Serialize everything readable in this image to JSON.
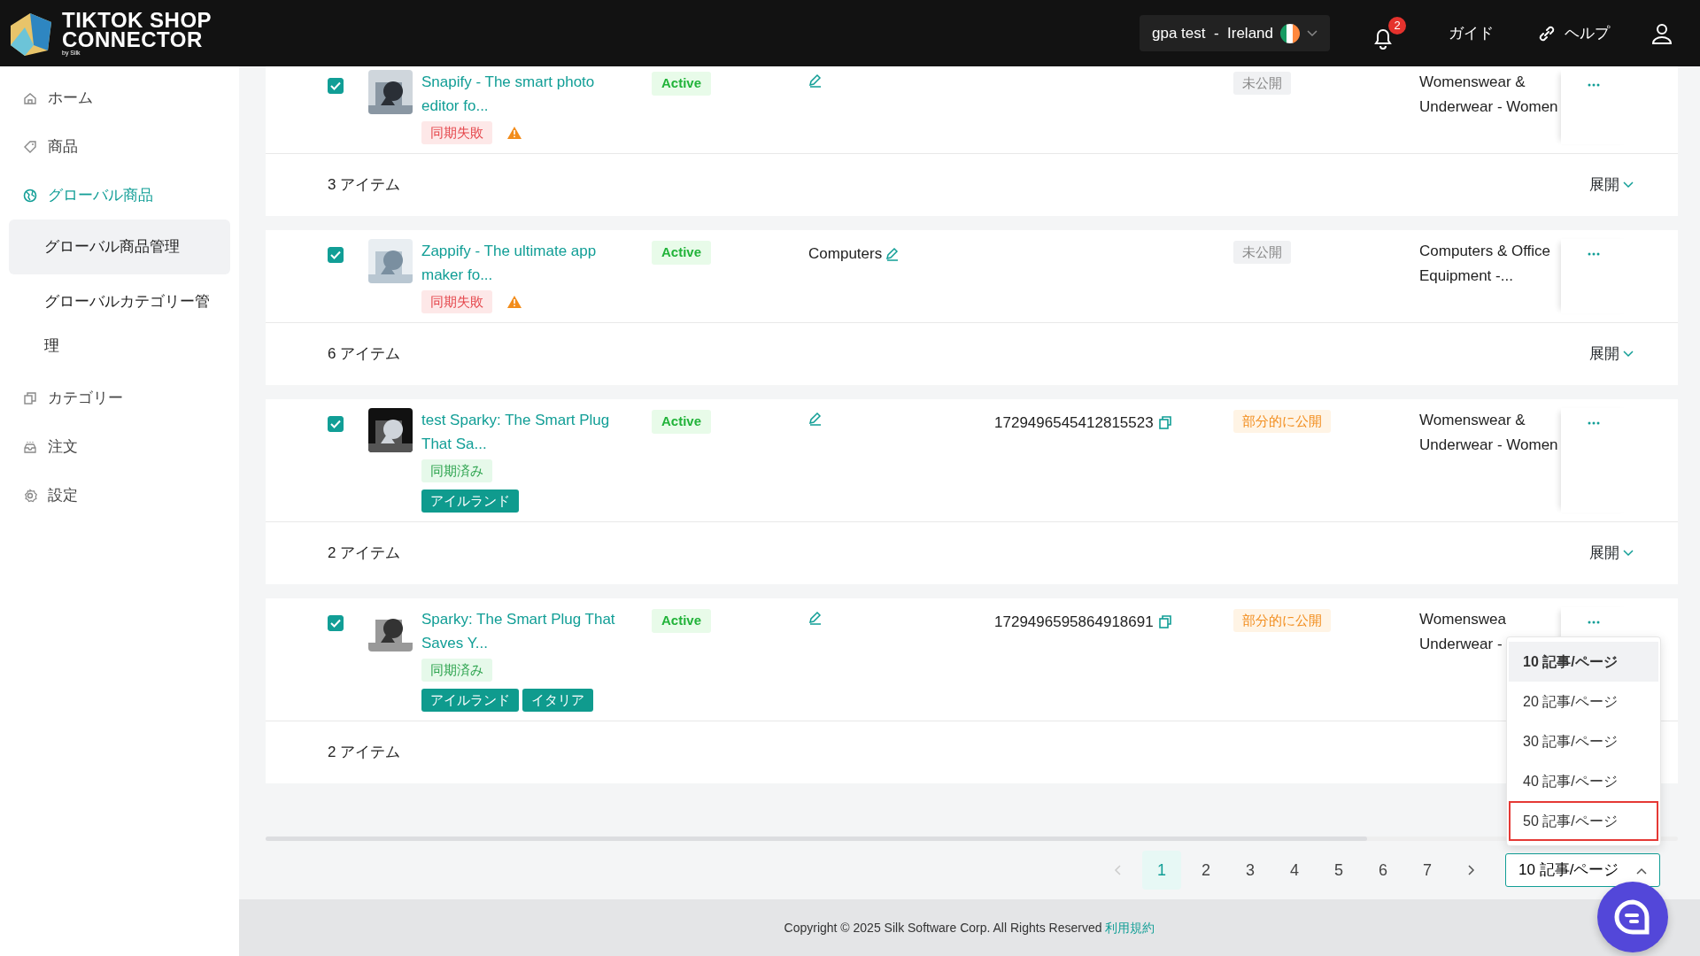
{
  "header": {
    "logo_lines": [
      "TIKTOK SHOP",
      "CONNECTOR"
    ],
    "logo_sub": "by Silk",
    "store": "gpa test  -  Ireland",
    "notification_count": "2",
    "links": [
      "ガイド",
      "ヘルプ"
    ]
  },
  "sidebar": {
    "items": [
      {
        "label": "ホーム",
        "selected": false
      },
      {
        "label": "商品",
        "selected": false
      },
      {
        "label": "グローバル商品",
        "selected": true,
        "expanded": true,
        "children": [
          {
            "label": "グローバル商品管理",
            "selected": true
          },
          {
            "label": "グローバルカテゴリー管理",
            "selected": false
          }
        ]
      },
      {
        "label": "カテゴリー",
        "selected": false
      },
      {
        "label": "注文",
        "selected": false
      },
      {
        "label": "設定",
        "selected": false
      }
    ]
  },
  "products": [
    {
      "checked": true,
      "title": "Snapify - The smart photo editor fo...",
      "status": "Active",
      "sync": {
        "text": "同期失敗",
        "kind": "failed"
      },
      "warning": true,
      "publish": {
        "text": "未公開",
        "kind": "unpublished"
      },
      "category_path": "Womenswear & Underwear - Women",
      "footer": {
        "count": "3 アイテム",
        "expand": "展開"
      }
    },
    {
      "checked": true,
      "title": "Zappify - The ultimate app maker fo...",
      "status": "Active",
      "category": "Computers",
      "sync": {
        "text": "同期失敗",
        "kind": "failed"
      },
      "warning": true,
      "publish": {
        "text": "未公開",
        "kind": "unpublished"
      },
      "category_path": "Computers & Office Equipment -...",
      "footer": {
        "count": "6 アイテム",
        "expand": "展開"
      }
    },
    {
      "checked": true,
      "title": "test Sparky: The Smart Plug That Sa...",
      "status": "Active",
      "product_id": "1729496545412815523",
      "sync": {
        "text": "同期済み",
        "kind": "synced"
      },
      "warning": false,
      "regions": [
        "アイルランド"
      ],
      "publish": {
        "text": "部分的に公開",
        "kind": "partial"
      },
      "category_path": "Womenswear & Underwear - Women",
      "footer": {
        "count": "2 アイテム",
        "expand": "展開"
      }
    },
    {
      "checked": true,
      "title": "Sparky: The Smart Plug That Saves Y...",
      "status": "Active",
      "product_id": "1729496595864918691",
      "sync": {
        "text": "同期済み",
        "kind": "synced"
      },
      "warning": false,
      "regions": [
        "アイルランド",
        "イタリア"
      ],
      "publish": {
        "text": "部分的に公開",
        "kind": "partial"
      },
      "category_path": "Womenswea Underwear -",
      "footer": {
        "count": "2 アイテム"
      }
    }
  ],
  "pagination": {
    "pages": [
      {
        "label": "1",
        "selected": true
      },
      {
        "label": "2",
        "selected": false
      },
      {
        "label": "3",
        "selected": false
      },
      {
        "label": "4",
        "selected": false
      },
      {
        "label": "5",
        "selected": false
      },
      {
        "label": "6",
        "selected": false
      },
      {
        "label": "7",
        "selected": false
      }
    ],
    "page_size": "10 記事/ページ",
    "expanded": true,
    "options": [
      {
        "label": "10 記事/ページ",
        "selected": true,
        "highlighted": false
      },
      {
        "label": "20 記事/ページ",
        "selected": false,
        "highlighted": false
      },
      {
        "label": "30 記事/ページ",
        "selected": false,
        "highlighted": false
      },
      {
        "label": "40 記事/ページ",
        "selected": false,
        "highlighted": false
      },
      {
        "label": "50 記事/ページ",
        "selected": false,
        "highlighted": true
      }
    ]
  },
  "footer": {
    "copyright": "Copyright © 2025 Silk Software Corp. All Rights Reserved",
    "link": "利用規約"
  }
}
